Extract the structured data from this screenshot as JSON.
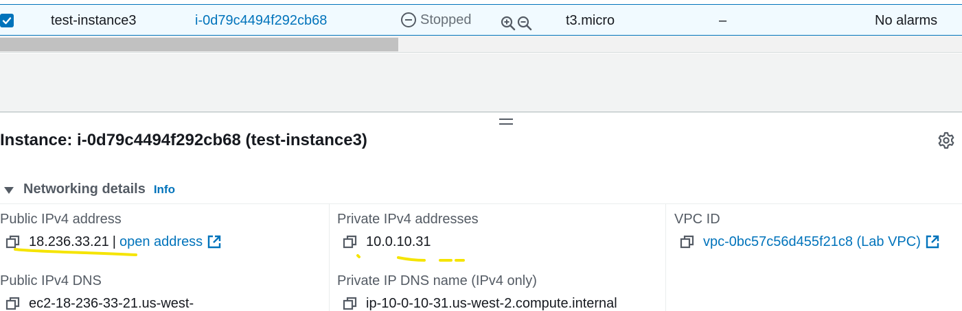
{
  "row": {
    "name": "test-instance3",
    "instance_id": "i-0d79c4494f292cb68",
    "state": "Stopped",
    "type": "t3.micro",
    "status_check": "–",
    "alarm": "No alarms"
  },
  "details": {
    "title": "Instance: i-0d79c4494f292cb68 (test-instance3)",
    "section_title": "Networking details",
    "info_label": "Info",
    "public_ipv4": {
      "label": "Public IPv4 address",
      "value": "18.236.33.21",
      "separator": "|",
      "link": "open address"
    },
    "private_ipv4": {
      "label": "Private IPv4 addresses",
      "value": "10.0.10.31"
    },
    "vpc": {
      "label": "VPC ID",
      "value": "vpc-0bc57c56d455f21c8 (Lab VPC)"
    },
    "public_dns": {
      "label": "Public IPv4 DNS",
      "value": "ec2-18-236-33-21.us-west-"
    },
    "private_dns": {
      "label": "Private IP DNS name (IPv4 only)",
      "value": "ip-10-0-10-31.us-west-2.compute.internal"
    }
  },
  "colors": {
    "link": "#0073bb",
    "highlight": "#f5e400",
    "selected_row": "#f1faff"
  },
  "icons": [
    "check-icon",
    "minus-circle-icon",
    "zoom-in-icon",
    "zoom-out-icon",
    "drag-handle-icon",
    "gear-icon",
    "caret-down-icon",
    "copy-icon",
    "external-link-icon"
  ]
}
